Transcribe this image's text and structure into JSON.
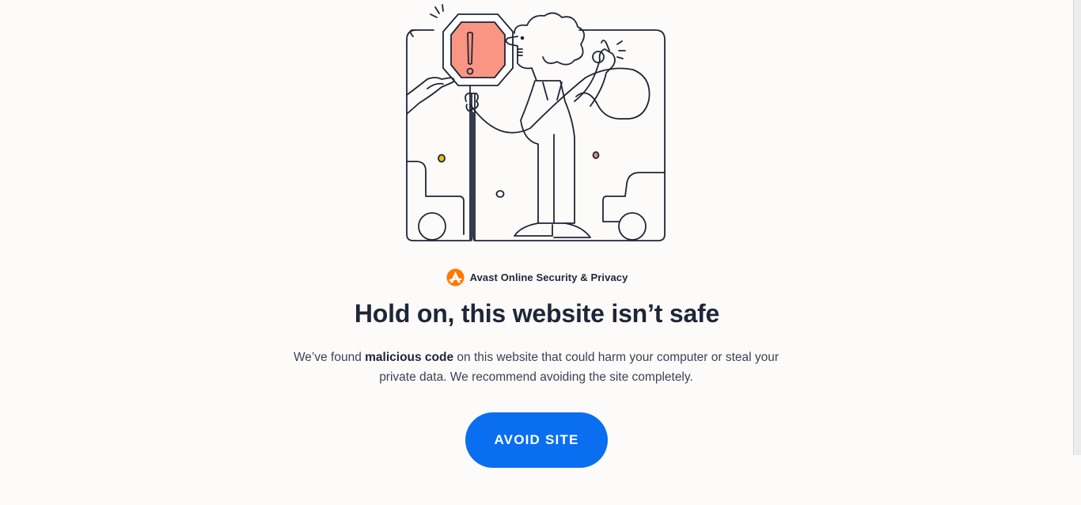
{
  "brand": {
    "name": "Avast Online Security & Privacy",
    "logo_icon": "avast-logo-icon",
    "logo_color": "#ff7800"
  },
  "warning": {
    "title": "Hold on, this website isn’t safe",
    "description_prefix": "We’ve found ",
    "description_bold": "malicious code",
    "description_suffix": " on this website that could harm your computer or steal your private data. We recommend avoiding the site completely."
  },
  "actions": {
    "avoid_label": "AVOID SITE",
    "avoid_color": "#0a6ef0"
  },
  "illustration": {
    "icon": "stop-sign-illustration",
    "stop_sign_color": "#fa9583",
    "accent_yellow": "#f2be00",
    "accent_coral": "#f0826e"
  }
}
